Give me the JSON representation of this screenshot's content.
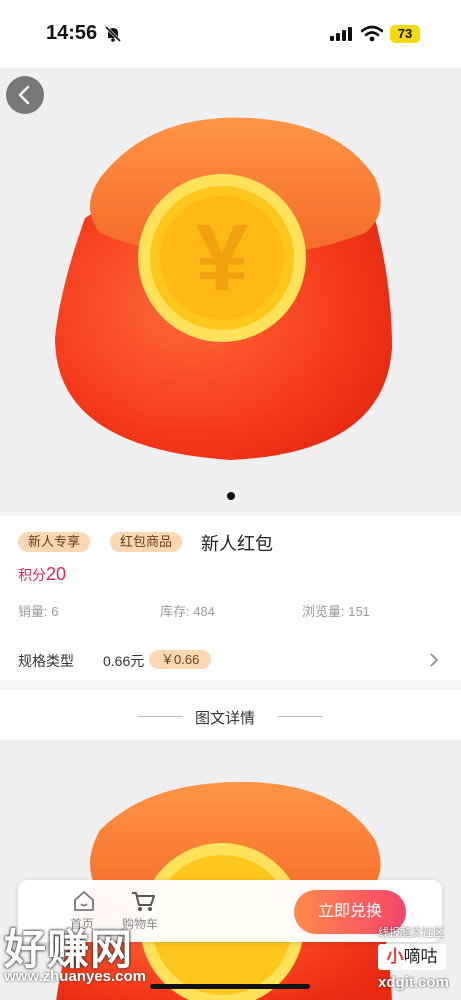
{
  "status_bar": {
    "time": "14:56",
    "battery": "73"
  },
  "product": {
    "tags": [
      "新人专享",
      "红包商品"
    ],
    "name": "新人红包",
    "points_label": "积分",
    "points_value": "20",
    "stats": {
      "sales": "销量: 6",
      "stock": "库存: 484",
      "views": "浏览量: 151"
    },
    "spec": {
      "label": "规格类型",
      "value": "0.66元",
      "price": "￥0.66"
    }
  },
  "image_symbol": "¥",
  "detail": {
    "title": "图文详情"
  },
  "bottom_bar": {
    "home_label": "首页",
    "cart_label": "购物车",
    "redeem_label": "立即兑换"
  },
  "watermarks": {
    "main": "好赚网",
    "url": "www.zhuanyes.com",
    "x_line": "线报酷文社区",
    "x_brand_prefix": "小",
    "x_brand_rest": "嘀咕",
    "x_url": "xdgit.com"
  },
  "colors": {
    "accent": "#e0245e",
    "tag_bg": "#fbd7b4",
    "button_gradient_start": "#ff8a4c",
    "button_gradient_end": "#f4446b"
  },
  "icons": [
    "bell-slash-icon",
    "signal-icon",
    "wifi-icon",
    "back-arrow-icon",
    "chevron-right-icon",
    "home-icon",
    "cart-icon"
  ]
}
